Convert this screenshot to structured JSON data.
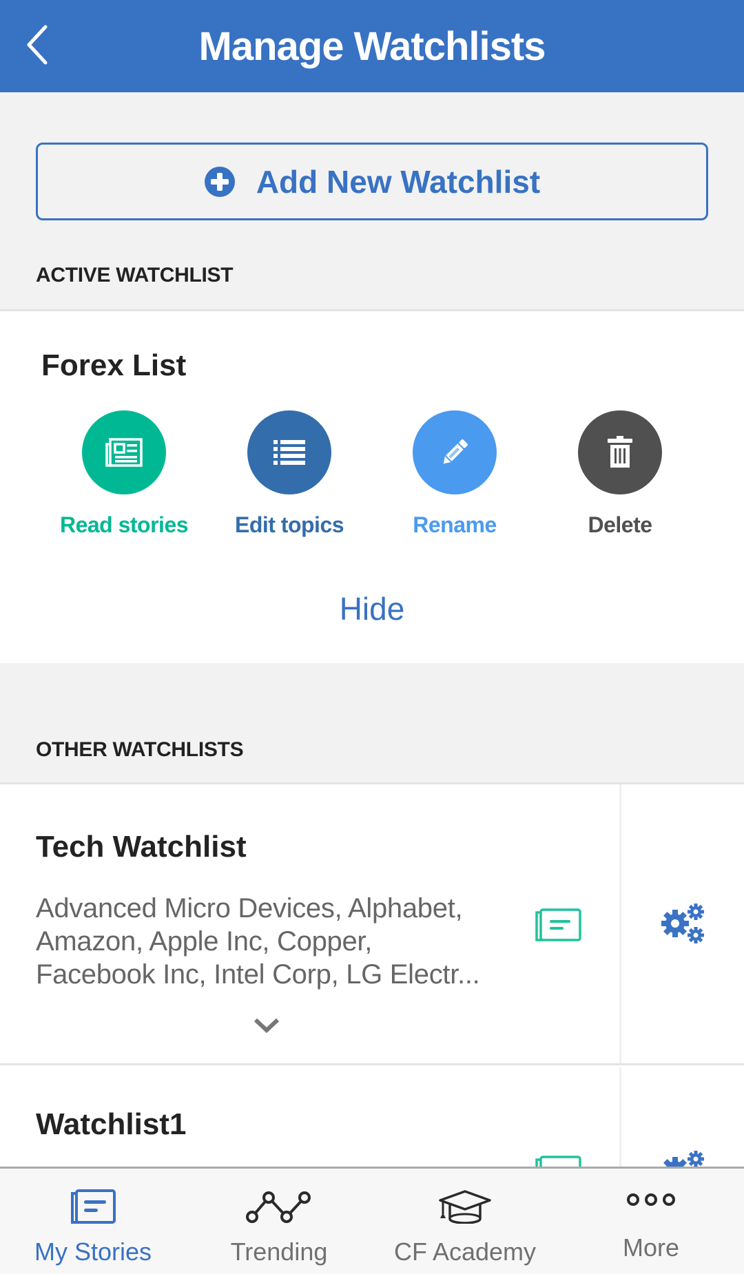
{
  "appbar": {
    "title": "Manage Watchlists",
    "back_icon": "chevron-left-icon"
  },
  "add_button": {
    "label": "Add New Watchlist",
    "icon": "plus-circle-icon"
  },
  "active_section": {
    "heading": "ACTIVE WATCHLIST",
    "watchlist_name": "Forex List",
    "actions": [
      {
        "label": "Read stories",
        "icon": "newspaper-icon",
        "color": "#00b894"
      },
      {
        "label": "Edit topics",
        "icon": "list-icon",
        "color": "#336dab"
      },
      {
        "label": "Rename",
        "icon": "pencil-icon",
        "color": "#4a9af0"
      },
      {
        "label": "Delete",
        "icon": "trash-icon",
        "color": "#505050"
      }
    ],
    "hide_label": "Hide"
  },
  "other_section": {
    "heading": "OTHER WATCHLISTS",
    "watchlists": [
      {
        "name": "Tech Watchlist",
        "topics_lines": [
          "Advanced Micro Devices, Alphabet,",
          "Amazon, Apple Inc, Copper,",
          "Facebook Inc, Intel Corp, LG Electr..."
        ]
      },
      {
        "name": "Watchlist1",
        "topics_lines": []
      }
    ]
  },
  "bottom_nav": {
    "items": [
      {
        "label": "My Stories",
        "icon": "stories-icon",
        "active": true
      },
      {
        "label": "Trending",
        "icon": "trending-icon",
        "active": false
      },
      {
        "label": "CF Academy",
        "icon": "graduation-cap-icon",
        "active": false
      },
      {
        "label": "More",
        "icon": "more-dots-icon",
        "active": false
      }
    ]
  },
  "colors": {
    "primary": "#3872c3",
    "accent_green": "#1fc39c",
    "background": "#f2f2f2"
  }
}
